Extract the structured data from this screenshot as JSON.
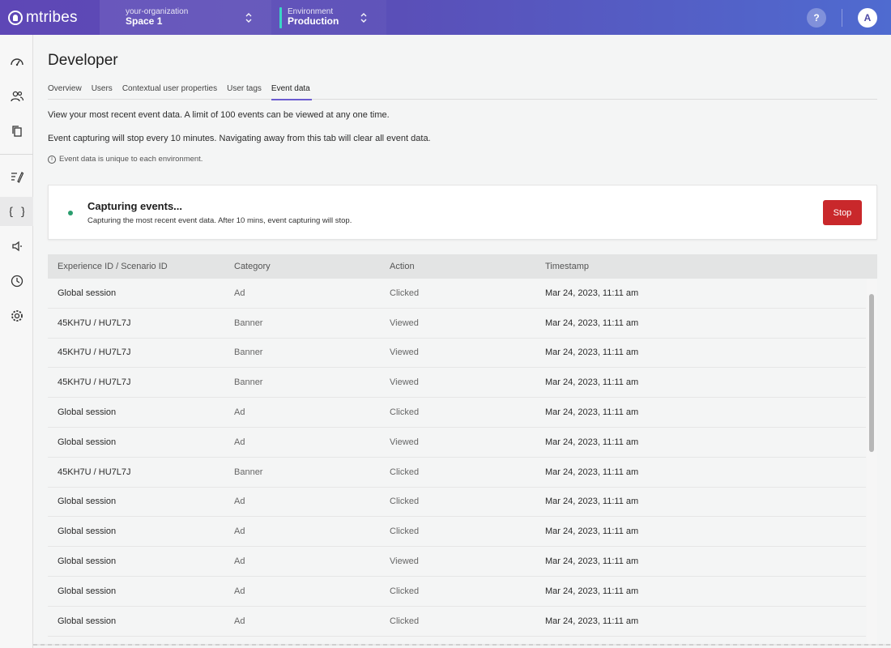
{
  "topbar": {
    "brand": "mtribes",
    "org": {
      "label": "your-organization",
      "value": "Space 1"
    },
    "env": {
      "label": "Environment",
      "value": "Production"
    },
    "help": "?",
    "avatar": "A"
  },
  "sidebar": {
    "items": [
      "dashboard-icon",
      "users-icon",
      "copy-icon",
      "edit-icon",
      "code-icon",
      "speaker-icon",
      "clock-icon",
      "gear-icon"
    ],
    "active": "code-icon"
  },
  "page": {
    "title": "Developer",
    "tabs": [
      "Overview",
      "Users",
      "Contextual user properties",
      "User tags",
      "Event data"
    ],
    "active_tab": "Event data",
    "info1": "View your most recent event data. A limit of 100 events can be viewed at any one time.",
    "info2": "Event capturing will stop every 10 minutes. Navigating away from this tab will clear all event data.",
    "note": "Event data is unique to each environment."
  },
  "capture": {
    "title": "Capturing events...",
    "subtitle": "Capturing the most recent event data.  After 10 mins, event capturing will stop.",
    "stop_label": "Stop",
    "status_color": "#2a9d6e"
  },
  "table": {
    "headers": [
      "Experience ID / Scenario ID",
      "Category",
      "Action",
      "Timestamp"
    ],
    "rows": [
      [
        "Global session",
        "Ad",
        "Clicked",
        "Mar 24, 2023, 11:11 am"
      ],
      [
        "45KH7U / HU7L7J",
        "Banner",
        "Viewed",
        "Mar 24, 2023, 11:11 am"
      ],
      [
        "45KH7U / HU7L7J",
        "Banner",
        "Viewed",
        "Mar 24, 2023, 11:11 am"
      ],
      [
        "45KH7U / HU7L7J",
        "Banner",
        "Viewed",
        "Mar 24, 2023, 11:11 am"
      ],
      [
        "Global session",
        "Ad",
        "Clicked",
        "Mar 24, 2023, 11:11 am"
      ],
      [
        "Global session",
        "Ad",
        "Viewed",
        "Mar 24, 2023, 11:11 am"
      ],
      [
        "45KH7U / HU7L7J",
        "Banner",
        "Clicked",
        "Mar 24, 2023, 11:11 am"
      ],
      [
        "Global session",
        "Ad",
        "Clicked",
        "Mar 24, 2023, 11:11 am"
      ],
      [
        "Global session",
        "Ad",
        "Clicked",
        "Mar 24, 2023, 11:11 am"
      ],
      [
        "Global session",
        "Ad",
        "Viewed",
        "Mar 24, 2023, 11:11 am"
      ],
      [
        "Global session",
        "Ad",
        "Clicked",
        "Mar 24, 2023, 11:11 am"
      ],
      [
        "Global session",
        "Ad",
        "Clicked",
        "Mar 24, 2023, 11:11 am"
      ]
    ]
  },
  "colors": {
    "accent": "#6c5cd0",
    "danger": "#c9282b",
    "topbar_start": "#5e47b6",
    "topbar_end": "#4f6bd0"
  }
}
